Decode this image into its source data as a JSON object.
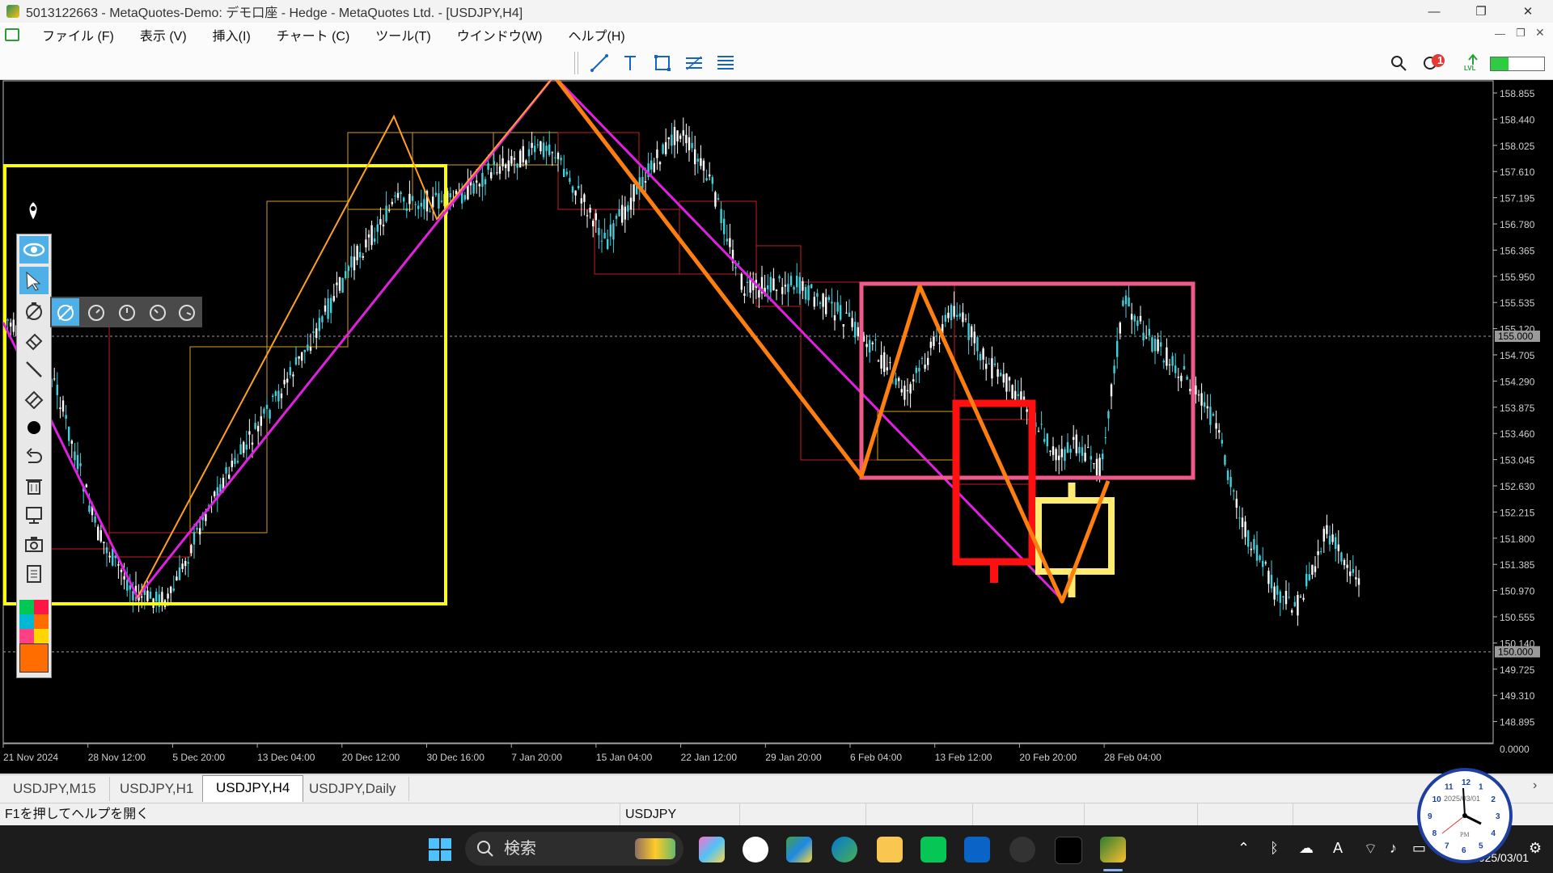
{
  "window": {
    "title": "5013122663 - MetaQuotes-Demo: デモ口座 - Hedge - MetaQuotes Ltd. - [USDJPY,H4]",
    "minimize": "—",
    "restore": "❐",
    "close": "✕"
  },
  "menu": [
    "ファイル (F)",
    "表示 (V)",
    "挿入(I)",
    "チャート (C)",
    "ツール(T)",
    "ウインドウ(W)",
    "ヘルプ(H)"
  ],
  "toolbar": {
    "notification_count": "1",
    "lvl_label": "LVL"
  },
  "chart": {
    "symbol": "USDJPY",
    "timeframe": "H4",
    "price_labels": [
      "158.855",
      "158.440",
      "158.025",
      "157.610",
      "157.195",
      "156.780",
      "156.365",
      "155.950",
      "155.535",
      "155.120",
      "154.705",
      "154.290",
      "153.875",
      "153.460",
      "153.045",
      "152.630",
      "152.215",
      "151.800",
      "151.385",
      "150.970",
      "150.555",
      "150.140",
      "149.725",
      "149.310",
      "148.895",
      "0.0000"
    ],
    "price_min": 148.895,
    "price_max": 158.855,
    "level_lines": [
      {
        "price": 155.0,
        "label": "155.000"
      },
      {
        "price": 150.0,
        "label": "150.000"
      }
    ],
    "time_labels": [
      "21 Nov 2024",
      "28 Nov 12:00",
      "5 Dec 20:00",
      "13 Dec 04:00",
      "20 Dec 12:00",
      "30 Dec 16:00",
      "7 Jan 20:00",
      "15 Jan 04:00",
      "22 Jan 12:00",
      "29 Jan 20:00",
      "6 Feb 04:00",
      "13 Feb 12:00",
      "20 Feb 20:00",
      "28 Feb 04:00"
    ],
    "colors": {
      "background": "#000000",
      "candles": "#3fd0dc",
      "candles_up": "#ffffff",
      "magenta_line": "#e020e0",
      "orange_zigzag": "#ff7f0e",
      "thin_orange": "#ffa020",
      "yellow_box": "#ffff00",
      "pink_box": "#f05a8a",
      "red_box": "#ff1010",
      "light_yellow_box": "#ffeb70"
    }
  },
  "tabs": [
    "USDJPY,M15",
    "USDJPY,H1",
    "USDJPY,H4",
    "USDJPY,Daily"
  ],
  "active_tab": "USDJPY,H4",
  "status": {
    "help": "F1を押してヘルプを開く",
    "symbol": "USDJPY"
  },
  "taskbar": {
    "search_placeholder": "検索",
    "date_partial": "2025/03/01",
    "clock_date": "2025/03/01",
    "clock_ampm": "PM",
    "clock_numbers": [
      "12",
      "1",
      "2",
      "3",
      "4",
      "5",
      "6",
      "7",
      "8",
      "9",
      "10",
      "11"
    ]
  }
}
